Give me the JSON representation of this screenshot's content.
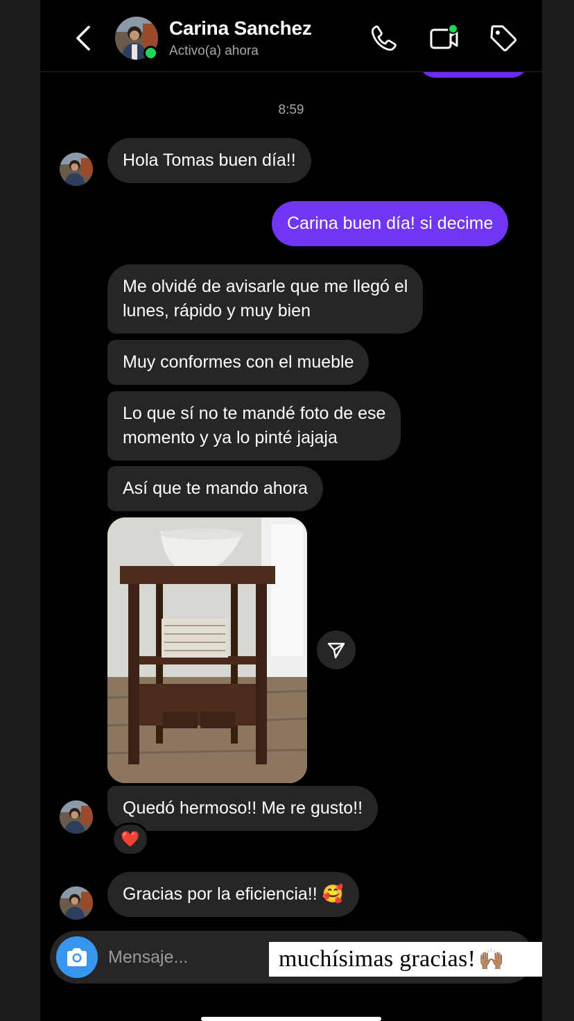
{
  "header": {
    "contact_name": "Carina Sanchez",
    "status": "Activo(a) ahora",
    "icons": [
      "back-chevron-icon",
      "phone-icon",
      "video-call-icon",
      "tag-icon"
    ]
  },
  "conversation": {
    "timestamp": "8:59",
    "messages": [
      {
        "from": "contact",
        "text": "Hola Tomas buen día!!"
      },
      {
        "from": "me",
        "text": "Carina buen día! si decime"
      },
      {
        "from": "contact",
        "text": "Me olvidé de avisarle que me llegó el\nlunes, rápido y muy bien"
      },
      {
        "from": "contact",
        "text": "Muy conformes con el mueble"
      },
      {
        "from": "contact",
        "text": "Lo que sí no te mandé foto de ese\nmomento y ya lo pinté jajaja"
      },
      {
        "from": "contact",
        "text": "Así que te mando ahora"
      },
      {
        "from": "contact",
        "type": "photo",
        "icon": "share-paper-plane-icon"
      },
      {
        "from": "contact",
        "text": "Quedó hermoso!! Me re gusto!!",
        "reaction": "❤️"
      },
      {
        "from": "contact",
        "text": "Gracias por la eficiencia!! 🥰"
      }
    ]
  },
  "composer": {
    "placeholder": "Mensaje...",
    "camera_icon": "camera-icon"
  },
  "sticker": {
    "text": "muchísimas gracias!",
    "emoji": "🙌🏽"
  },
  "colors": {
    "outgoing_bubble": "#7135f4",
    "incoming_bubble": "#262626",
    "online": "#1fd65a",
    "camera_button": "#3797f0"
  }
}
